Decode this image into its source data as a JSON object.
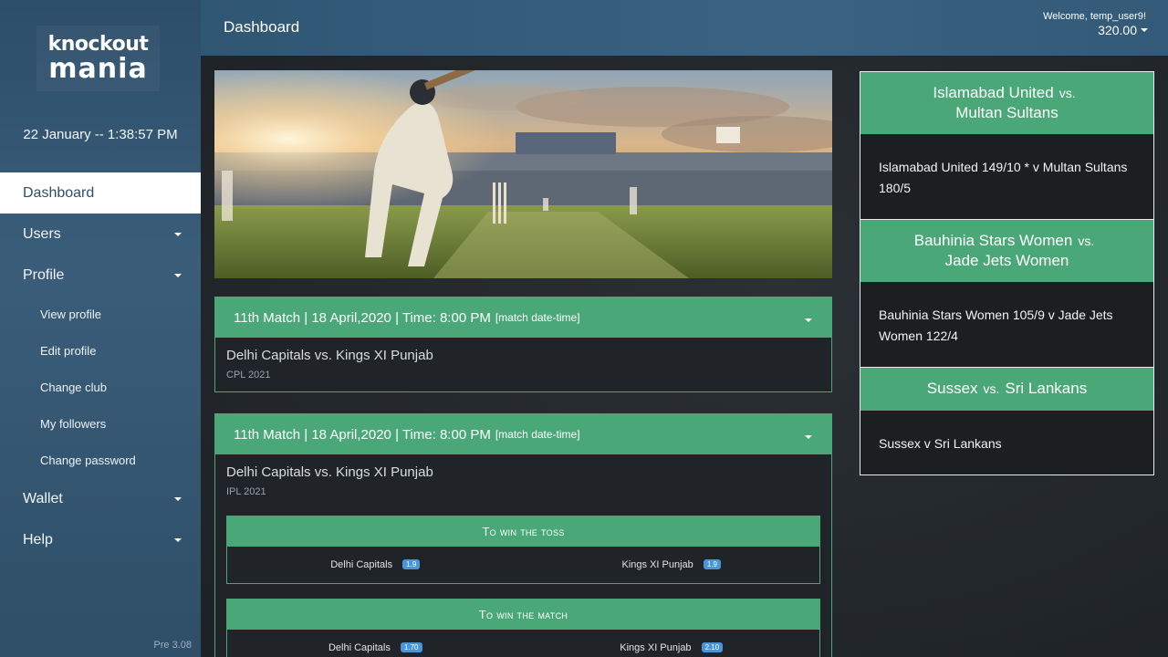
{
  "brand": {
    "logo_top": "knockout",
    "logo_bottom": "mania"
  },
  "clock": "22 January -- 1:38:57 PM",
  "sidebar": {
    "items": [
      {
        "label": "Dashboard"
      },
      {
        "label": "Users"
      },
      {
        "label": "Profile"
      },
      {
        "label": "Wallet"
      },
      {
        "label": "Help"
      }
    ],
    "profile_sub": [
      "View profile",
      "Edit profile",
      "Change club",
      "My followers",
      "Change password"
    ],
    "version": "Pre 3.08"
  },
  "header": {
    "title": "Dashboard",
    "welcome": "Welcome, temp_user9!",
    "balance": "320.00"
  },
  "matches": [
    {
      "title": "11th Match | 18 April,2020 | Time: 8:00 PM",
      "hint": "[match date-time]",
      "teams": "Delhi Capitals vs. Kings XI Punjab",
      "league": "CPL 2021"
    },
    {
      "title": "11th Match | 18 April,2020 | Time: 8:00 PM",
      "hint": "[match date-time]",
      "teams": "Delhi Capitals vs. Kings XI Punjab",
      "league": "IPL 2021",
      "bets": [
        {
          "title": "To win the toss",
          "options": [
            {
              "team": "Delhi Capitals",
              "odds": "1.9"
            },
            {
              "team": "Kings XI Punjab",
              "odds": "1.9"
            }
          ]
        },
        {
          "title": "To win the match",
          "options": [
            {
              "team": "Delhi Capitals",
              "odds": "1.70"
            },
            {
              "team": "Kings XI Punjab",
              "odds": "2.10"
            }
          ]
        }
      ]
    }
  ],
  "scores": [
    {
      "team1": "Islamabad United",
      "vs": "vs.",
      "team2": "Multan Sultans",
      "result": "Islamabad United 149/10 * v Multan Sultans 180/5"
    },
    {
      "team1": "Bauhinia Stars Women",
      "vs": "vs.",
      "team2": "Jade Jets Women",
      "result": "Bauhinia Stars Women 105/9 v Jade Jets Women 122/4"
    },
    {
      "team1": "Sussex",
      "vs": "vs.",
      "team2": "Sri Lankans",
      "result": "Sussex v Sri Lankans"
    }
  ],
  "colors": {
    "accent": "#4aa878",
    "sidebar": "#335571",
    "odds": "#4a95d8"
  }
}
